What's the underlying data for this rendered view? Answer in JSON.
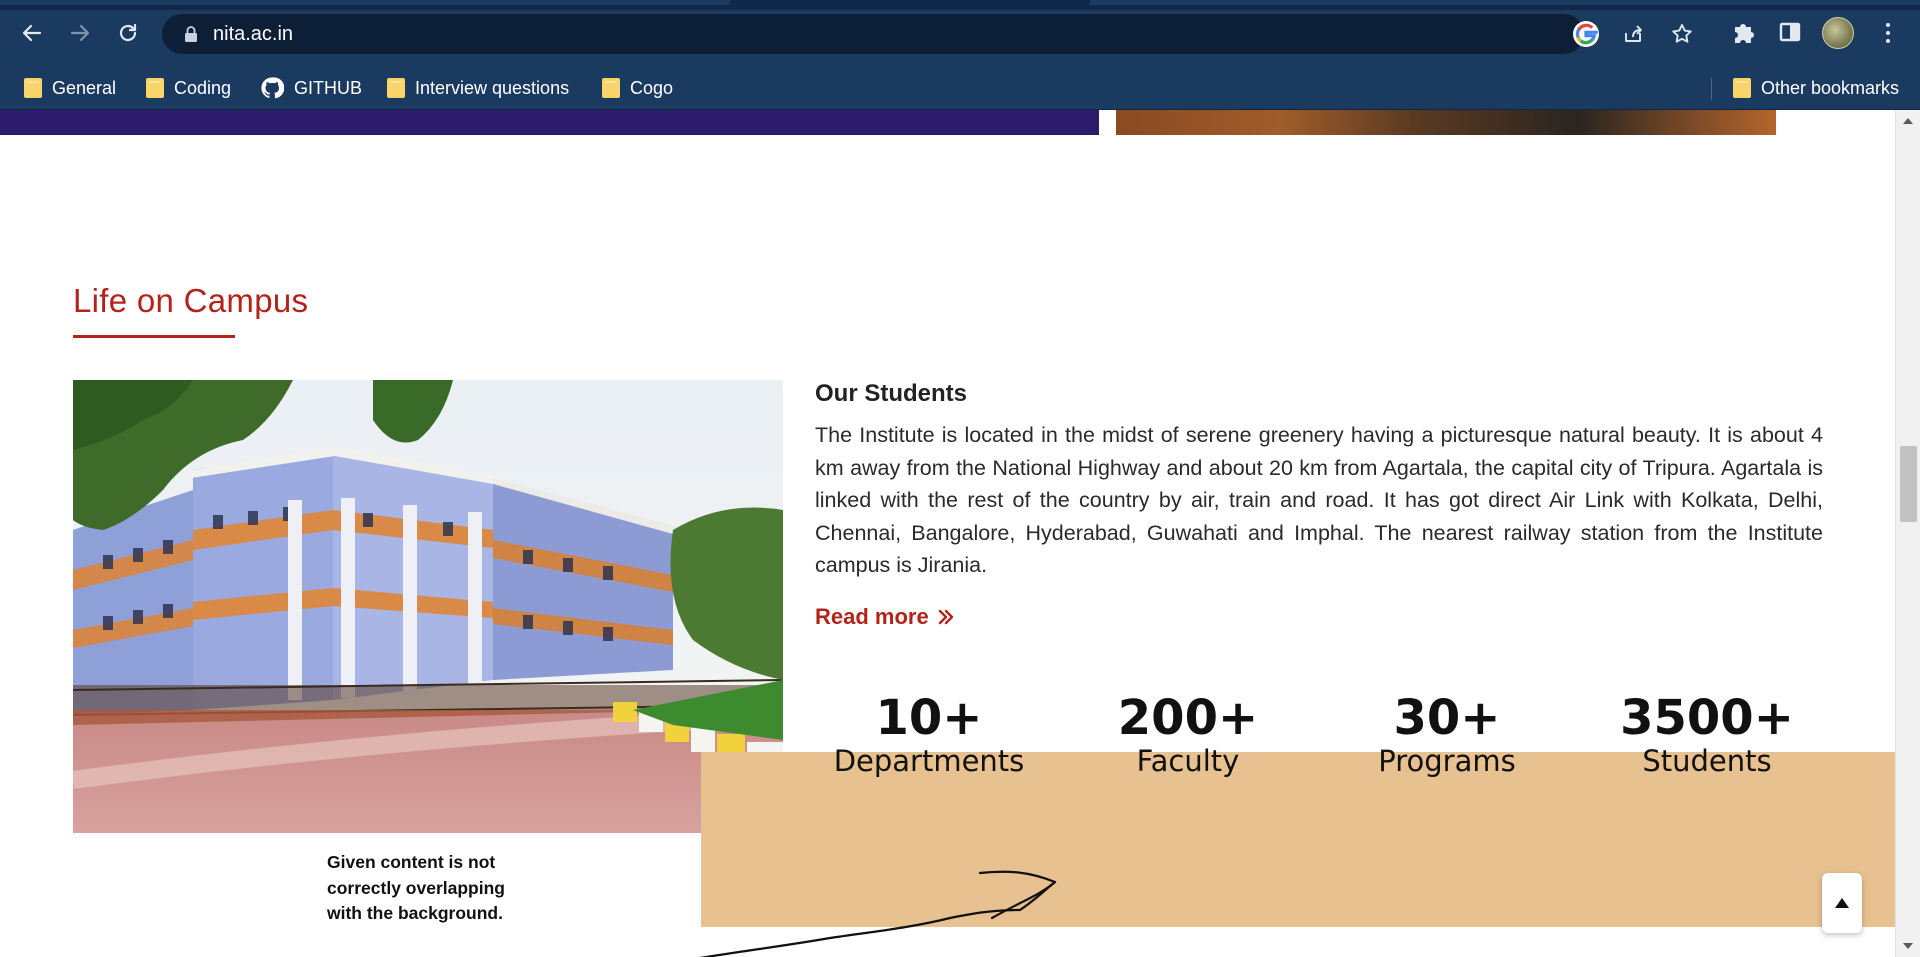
{
  "browser": {
    "url": "nita.ac.in",
    "bookmarks": [
      {
        "label": "General",
        "icon": "folder-icon"
      },
      {
        "label": "Coding",
        "icon": "folder-icon"
      },
      {
        "label": "GITHUB",
        "icon": "github-icon"
      },
      {
        "label": "Interview questions",
        "icon": "folder-icon"
      },
      {
        "label": "Cogo",
        "icon": "folder-icon"
      }
    ],
    "other_bookmarks": "Other bookmarks"
  },
  "section": {
    "title": "Life on Campus"
  },
  "students": {
    "title": "Our Students",
    "body": "The Institute is located in the midst of serene greenery having a picturesque natural beauty. It is about 4 km away from the National Highway and about 20 km from Agartala, the capital city of Tripura. Agartala is linked with the rest of the country by air, train and road. It has got direct Air Link with Kolkata, Delhi, Chennai, Bangalore, Hyderabad, Guwahati and Imphal. The nearest railway station from the Institute campus is Jirania.",
    "read_more": "Read more"
  },
  "stats": [
    {
      "value": "10+",
      "label": "Departments"
    },
    {
      "value": "200+",
      "label": "Faculty"
    },
    {
      "value": "30+",
      "label": "Programs"
    },
    {
      "value": "3500+",
      "label": "Students"
    }
  ],
  "annotation": {
    "line1": "Given content is not",
    "line2": "correctly overlapping",
    "line3": "with the background."
  },
  "colors": {
    "accent": "#b3231a",
    "stats_background": "#e8c190",
    "chrome": "#1b3a5f"
  }
}
